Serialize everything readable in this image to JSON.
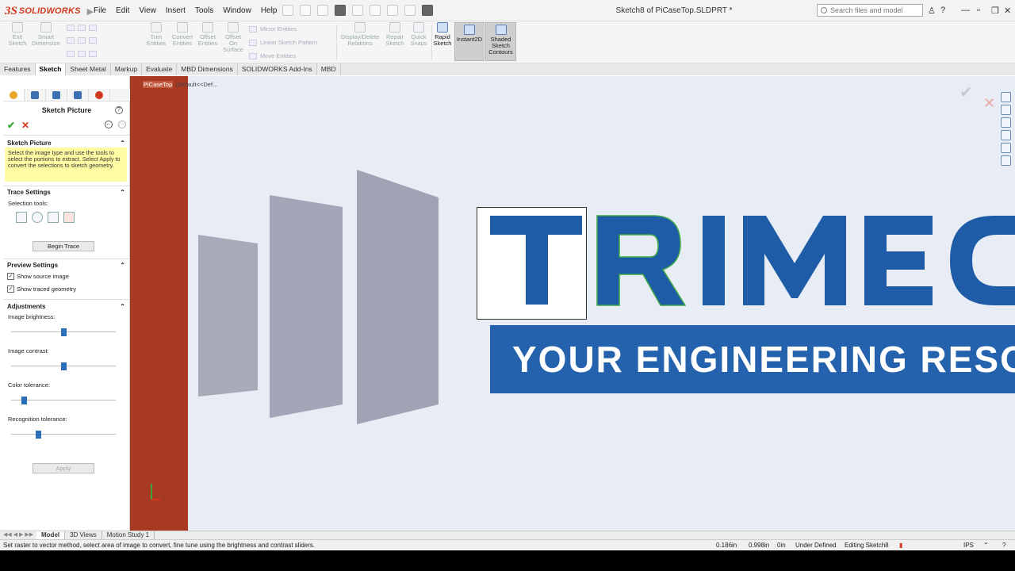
{
  "titlebar": {
    "app_name": "SOLIDWORKS",
    "menus": [
      "File",
      "Edit",
      "View",
      "Insert",
      "Tools",
      "Window",
      "Help"
    ],
    "document_title": "Sketch8 of PiCaseTop.SLDPRT *",
    "search_placeholder": "Search files and model"
  },
  "command_manager": {
    "tools": [
      {
        "label": "Exit\nSketch",
        "enabled": false
      },
      {
        "label": "Smart\nDimension",
        "enabled": false
      },
      {
        "label": "Trim\nEntities",
        "enabled": false
      },
      {
        "label": "Convert\nEntities",
        "enabled": false
      },
      {
        "label": "Offset\nEntities",
        "enabled": false
      },
      {
        "label": "Offset\nOn\nSurface",
        "enabled": false
      },
      {
        "label": "Display/Delete\nRelations",
        "enabled": false
      },
      {
        "label": "Repair\nSketch",
        "enabled": false
      },
      {
        "label": "Quick\nSnaps",
        "enabled": false
      },
      {
        "label": "Rapid\nSketch",
        "enabled": true
      },
      {
        "label": "Instant2D",
        "enabled": true
      },
      {
        "label": "Shaded\nSketch\nContours",
        "enabled": true
      }
    ],
    "small_tools": [
      "Mirror Entities",
      "Linear Sketch Pattern",
      "Move Entities"
    ]
  },
  "tabs": [
    {
      "label": "Features",
      "selected": false
    },
    {
      "label": "Sketch",
      "selected": true
    },
    {
      "label": "Sheet Metal",
      "selected": false
    },
    {
      "label": "Markup",
      "selected": false
    },
    {
      "label": "Evaluate",
      "selected": false
    },
    {
      "label": "MBD Dimensions",
      "selected": false
    },
    {
      "label": "SOLIDWORKS Add-Ins",
      "selected": false
    },
    {
      "label": "MBD",
      "selected": false
    }
  ],
  "property_manager": {
    "title": "Sketch Picture",
    "section_sketch_picture": "Sketch Picture",
    "hint": "Select the image type and use the tools to select the portions to extract. Select Apply to convert the selections to sketch geometry.",
    "section_trace": "Trace Settings",
    "selection_tools_label": "Selection tools:",
    "begin_trace": "Begin Trace",
    "section_preview": "Preview Settings",
    "show_source": "Show source image",
    "show_traced": "Show traced geometry",
    "section_adjustments": "Adjustments",
    "sliders": [
      {
        "label": "Image brightness:",
        "value": 0.5
      },
      {
        "label": "Image contrast:",
        "value": 0.5
      },
      {
        "label": "Color tolerance:",
        "value": 0.1
      },
      {
        "label": "Recognition tolerance:",
        "value": 0.25
      }
    ],
    "apply": "Apply"
  },
  "graphics": {
    "tree_part": "PiCaseTop",
    "tree_config": "(Default<<Def...",
    "logo_text": "TRIMEC",
    "banner_text": "YOUR ENGINEERING RESO"
  },
  "bottom_tabs": [
    {
      "label": "Model",
      "selected": true
    },
    {
      "label": "3D Views",
      "selected": false
    },
    {
      "label": "Motion Study 1",
      "selected": false
    }
  ],
  "status": {
    "message": "Set raster to vector method, select area of image to convert, fine tune using the brightness and contrast sliders.",
    "x": "0.186in",
    "y": "0.998in",
    "z": "0in",
    "state": "Under Defined",
    "editing": "Editing Sketch8",
    "units": "IPS"
  },
  "colors": {
    "brand_red": "#d2381c",
    "logo_blue": "#1f5ca8",
    "banner_blue": "#2462ae",
    "trace_green": "#3ca848"
  }
}
